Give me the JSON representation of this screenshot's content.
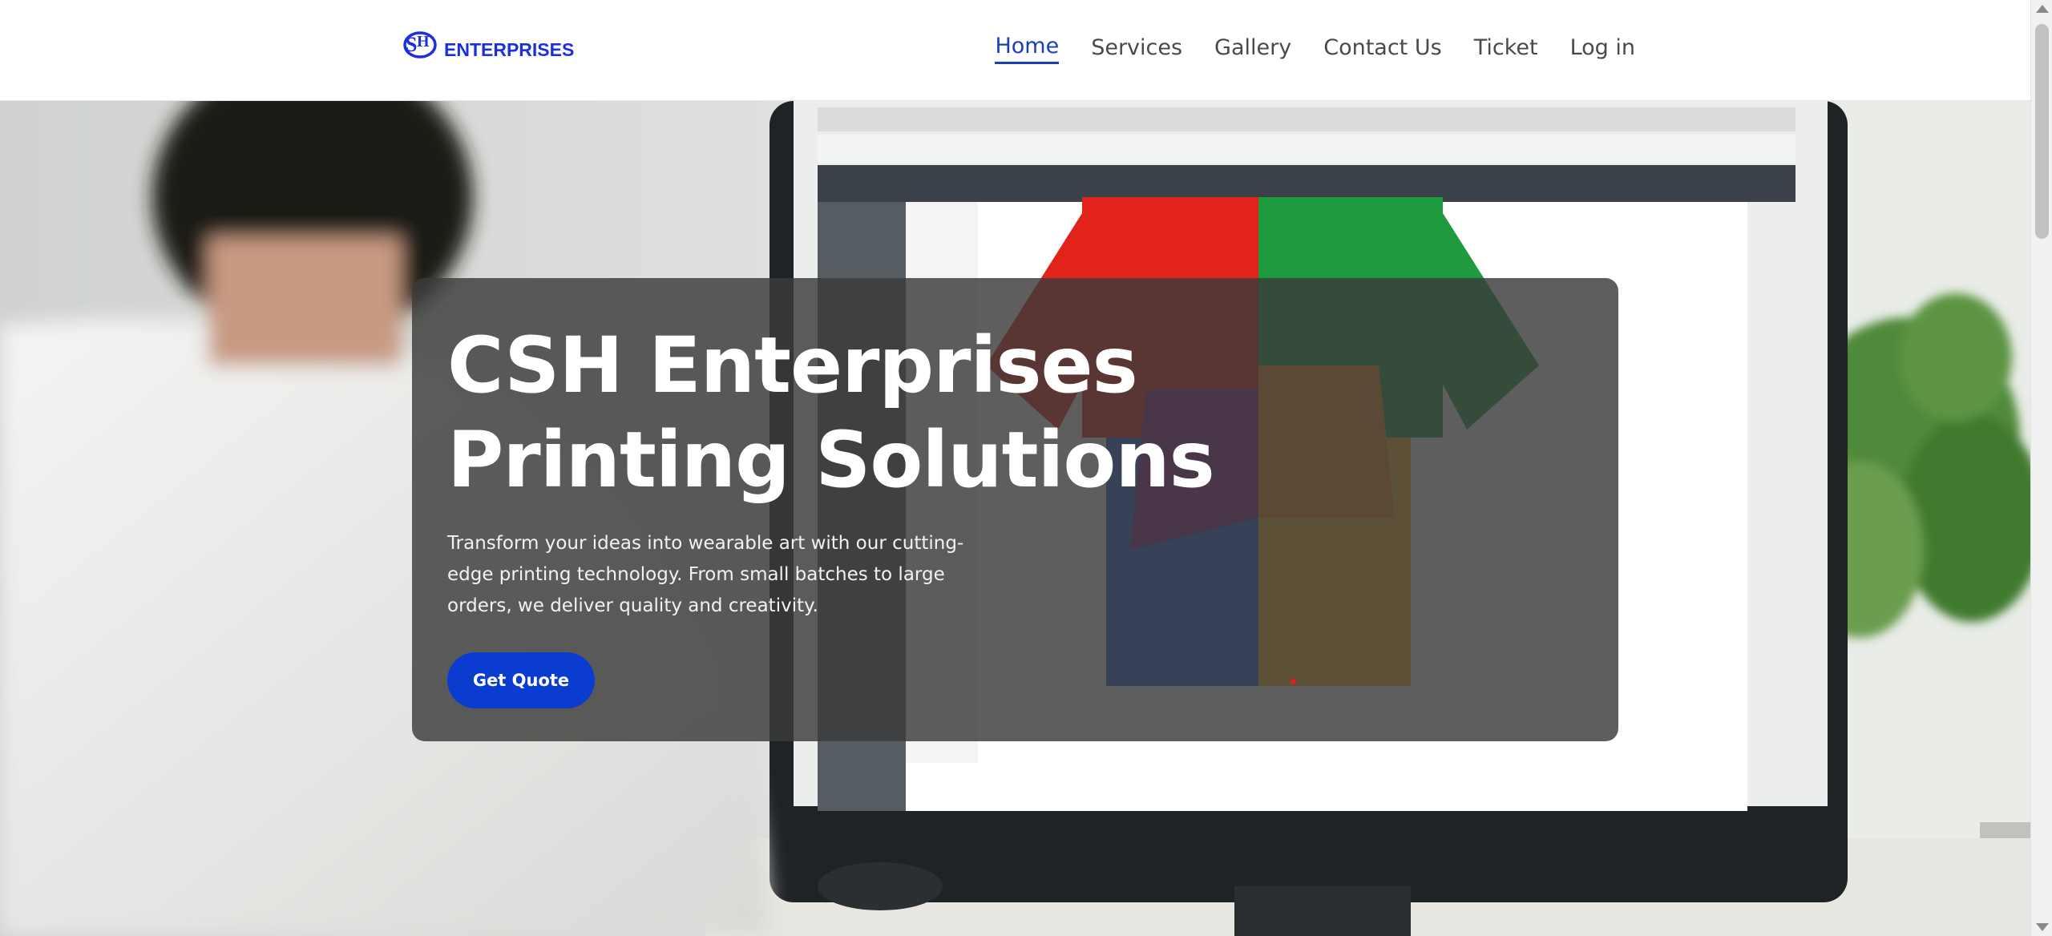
{
  "brand": {
    "logo_icon": "csh-monogram-icon",
    "name": "ENTERPRISES",
    "color": "#1c2ee0"
  },
  "nav": {
    "active": "Home",
    "items": [
      {
        "label": "Home"
      },
      {
        "label": "Services"
      },
      {
        "label": "Gallery"
      },
      {
        "label": "Contact Us"
      },
      {
        "label": "Ticket"
      },
      {
        "label": "Log in"
      }
    ]
  },
  "hero": {
    "title": "CSH Enterprises Printing Solutions",
    "description": "Transform your ideas into wearable art with our cutting-edge printing technology. From small batches to large orders, we deliver quality and creativity.",
    "cta_label": "Get Quote",
    "cta_color": "#0b3cd0",
    "background_image": "person designing a multicolor t-shirt on a computer monitor"
  },
  "colors": {
    "accent": "#1a3fb8",
    "nav_text": "#4a4a4a",
    "card_overlay": "#3a3a3a"
  }
}
